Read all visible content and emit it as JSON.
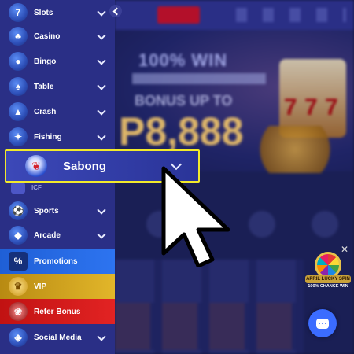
{
  "background": {
    "banner_line1": "100% WIN",
    "banner_line2": "BONUS UP TO",
    "banner_amount": "P8,888"
  },
  "sidebar": {
    "items": [
      {
        "label": "Slots",
        "icon": "slots-icon"
      },
      {
        "label": "Casino",
        "icon": "casino-icon"
      },
      {
        "label": "Bingo",
        "icon": "bingo-icon"
      },
      {
        "label": "Table",
        "icon": "table-icon"
      },
      {
        "label": "Crash",
        "icon": "crash-icon"
      },
      {
        "label": "Fishing",
        "icon": "fishing-icon"
      },
      {
        "label": "Sports",
        "icon": "sports-icon"
      },
      {
        "label": "Arcade",
        "icon": "arcade-icon"
      },
      {
        "label": "Promotions",
        "icon": "promotions-icon"
      },
      {
        "label": "VIP",
        "icon": "vip-icon"
      },
      {
        "label": "Refer Bonus",
        "icon": "refer-bonus-icon"
      },
      {
        "label": "Social Media",
        "icon": "social-media-icon"
      }
    ],
    "highlighted": {
      "label": "Sabong",
      "icon": "rooster-icon"
    },
    "sub_label": "ICF"
  },
  "widgets": {
    "lucky_spin_title": "APRIL LUCKY SPIN",
    "lucky_spin_sub": "100% CHANCE WIN"
  },
  "colors": {
    "sidebar_bg": "#2a2f86",
    "highlight_border": "#f2ea2b",
    "promotions": "#2d74f0",
    "vip": "#e2b62a",
    "refer": "#e22323"
  }
}
